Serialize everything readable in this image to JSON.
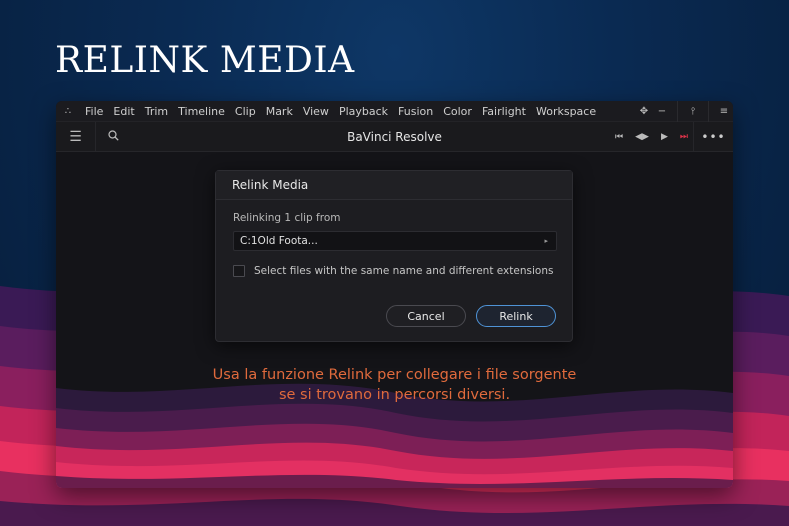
{
  "page": {
    "heading": "RELINK MEDIA"
  },
  "menubar": {
    "logo_icon": "resolve-logo-icon",
    "items": [
      "File",
      "Edit",
      "Trim",
      "Timeline",
      "Clip",
      "Mark",
      "View",
      "Playback",
      "Fusion",
      "Color",
      "Fairlight",
      "Workspace"
    ]
  },
  "toolbar": {
    "title": "BaVinci Resolve"
  },
  "dialog": {
    "title": "Relink Media",
    "relinking_label": "Relinking 1 clip from",
    "path_value": "C:1Old Foota...",
    "checkbox_label": "Select files with the same name and different extensions",
    "checkbox_checked": false,
    "cancel_label": "Cancel",
    "relink_label": "Relink"
  },
  "caption": {
    "line1": "Usa la funzione Relink per collegare i file sorgente",
    "line2": "se si trovano in percorsi diversi."
  },
  "colors": {
    "accent_blue": "#4f93d6",
    "caption_orange": "#e06a3c",
    "record_red": "#e0334a"
  }
}
